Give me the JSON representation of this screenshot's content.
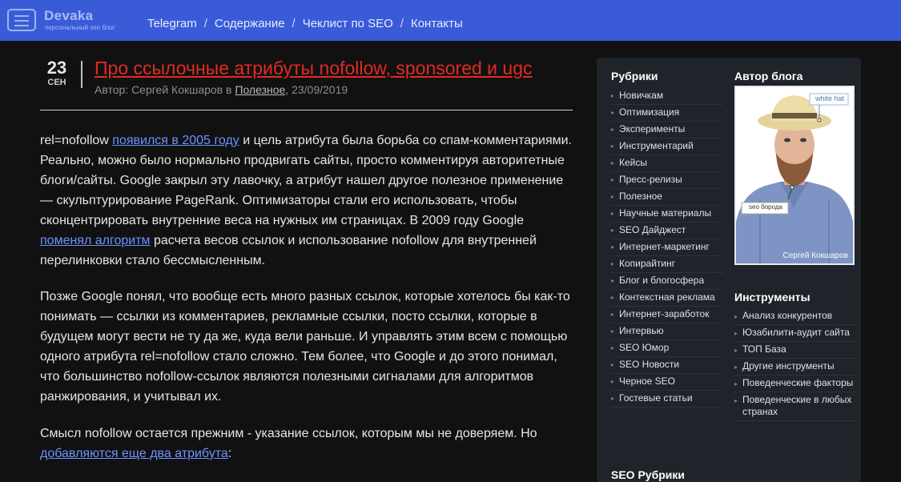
{
  "header": {
    "logo": "Devaka",
    "logo_subtitle": "персональный seo блог",
    "nav": [
      "Telegram",
      "Содержание",
      "Чеклист по SEO",
      "Контакты"
    ],
    "nav_separator": "/",
    "bar_color": "#3a5bd8",
    "icons": {
      "menu": "hamburger-icon"
    }
  },
  "post": {
    "day": "23",
    "month": "СЕН",
    "title": "Про ссылочные атрибуты nofollow, sponsored и ugc",
    "meta_prefix": "Автор: Сергей Кокшаров в ",
    "meta_category": "Полезное",
    "meta_suffix": ", 23/09/2019",
    "title_color": "#e52a20",
    "link_color": "#6f92ff",
    "p1_a": "rel=nofollow ",
    "p1_link": "появился в 2005 году",
    "p1_b": " и цель атрибута была борьба со спам-комментариями. Реально, можно было нормально продвигать сайты, просто комментируя авторитетные блоги/сайты. Google закрыл эту лавочку, а атрибут нашел другое полезное применение — скульптурирование PageRank. Оптимизаторы стали его использовать, чтобы сконцентрировать внутренние веса на нужных им страницах. В 2009 году Google ",
    "p1_link2": "поменял алгоритм",
    "p1_c": " расчета весов ссылок и использование nofollow для внутренней перелинковки стало бессмысленным.",
    "p2": "Позже Google понял, что вообще есть много разных ссылок, которые хотелось бы как-то понимать — ссылки из комментариев, рекламные ссылки, посто ссылки, которые в будущем могут вести не ту да же, куда вели раньше. И управлять этим всем с помощью одного атрибута rel=nofollow стало сложно. Тем более, что Google и до этого понимал, что большинство nofollow-ссылок являются полезными сигналами для алгоритмов ранжирования, и учитывал их.",
    "p3_a": "Смысл nofollow остается прежним - указание ссылок, которым мы не доверяем. Но ",
    "p3_link": "добавляются еще два атрибута",
    "p3_b": ":"
  },
  "sidebar": {
    "rubrics_title": "Рубрики",
    "rubrics": [
      "Новичкам",
      "Оптимизация",
      "Эксперименты",
      "Инструментарий",
      "Кейсы",
      "Пресс-релизы",
      "Полезное",
      "Научные материалы",
      "SEO Дайджест",
      "Интернет-маркетинг",
      "Копирайтинг",
      "Блог и блогосфера",
      "Контекстная реклама",
      "Интернет-заработок",
      "Интервью",
      "SEO Юмор",
      "SEO Новости",
      "Черное SEO",
      "Гостевые статьи"
    ],
    "author_title": "Автор блога",
    "photo_tag_hat": "white hat",
    "photo_tag_beard": "seo борода",
    "photo_caption": "Сергей Кокшаров",
    "tools_title": "Инструменты",
    "tools": [
      "Анализ конкурентов",
      "Юзабилити-аудит сайта",
      "ТОП База",
      "Другие инструменты",
      "Поведенческие факторы",
      "Поведенческие в любых странах"
    ],
    "bottom_cut_title": "SEO Рубрики",
    "bg_color": "#1f232a"
  }
}
